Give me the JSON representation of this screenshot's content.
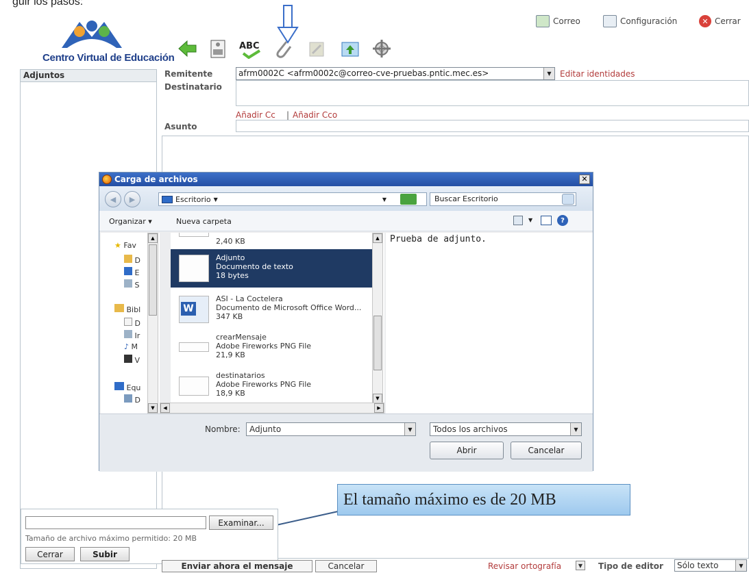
{
  "clipped_heading": "guir los pasos:",
  "header": {
    "app_name": "Centro Virtual de Educación",
    "links": [
      {
        "label": "Correo",
        "icon": "mail-icon"
      },
      {
        "label": "Configuración",
        "icon": "settings-icon"
      },
      {
        "label": "Cerrar",
        "icon": "close-red-icon"
      }
    ]
  },
  "toolbar": {
    "icons": [
      "back-arrow-icon",
      "print-icon",
      "spellcheck-icon",
      "attach-paperclip-icon",
      "contacts-icon",
      "save-draft-icon",
      "settings-gear-icon"
    ],
    "spellcheck_label": "ABC"
  },
  "sidebar": {
    "title": "Adjuntos"
  },
  "compose": {
    "sender_label": "Remitente",
    "sender_value": "afrm0002C <afrm0002c@correo-cve-pruebas.pntic.mec.es>",
    "edit_identities": "Editar identidades",
    "recipient_label": "Destinatario",
    "add_cc": "Añadir Cc",
    "separator": "|",
    "add_bcc": "Añadir Cco",
    "subject_label": "Asunto"
  },
  "dialog": {
    "title": "Carga de archivos",
    "location": "Escritorio",
    "search_placeholder": "Buscar Escritorio",
    "organize": "Organizar",
    "new_folder": "Nueva carpeta",
    "nav": [
      "Fav",
      "D",
      "E",
      "S",
      "Bibl",
      "D",
      "Ir",
      "M",
      "V",
      "Equ",
      "D"
    ],
    "files": [
      {
        "name": "",
        "type": "",
        "size": "2,40 KB"
      },
      {
        "name": "Adjunto",
        "type": "Documento de texto",
        "size": "18 bytes",
        "selected": true
      },
      {
        "name": "ASI - La Coctelera",
        "type": "Documento de Microsoft Office Word...",
        "size": "347 KB"
      },
      {
        "name": "crearMensaje",
        "type": "Adobe Fireworks PNG File",
        "size": "21,9 KB"
      },
      {
        "name": "destinatarios",
        "type": "Adobe Fireworks PNG File",
        "size": "18,9 KB"
      }
    ],
    "preview_text": "Prueba de adjunto.",
    "filename_label": "Nombre:",
    "filename_value": "Adjunto",
    "filter_value": "Todos los archivos",
    "open_button": "Abrir",
    "cancel_button": "Cancelar"
  },
  "callout": "El tamaño máximo es de 20 MB",
  "upload": {
    "browse_button": "Examinar...",
    "max_size_text": "Tamaño de archivo máximo permitido: 20 MB",
    "close_button": "Cerrar",
    "upload_button": "Subir"
  },
  "footer": {
    "send_now": "Enviar ahora el mensaje",
    "cancel": "Cancelar",
    "spellcheck": "Revisar ortografía",
    "editor_type_label": "Tipo de editor",
    "editor_type_value": "Sólo texto"
  }
}
